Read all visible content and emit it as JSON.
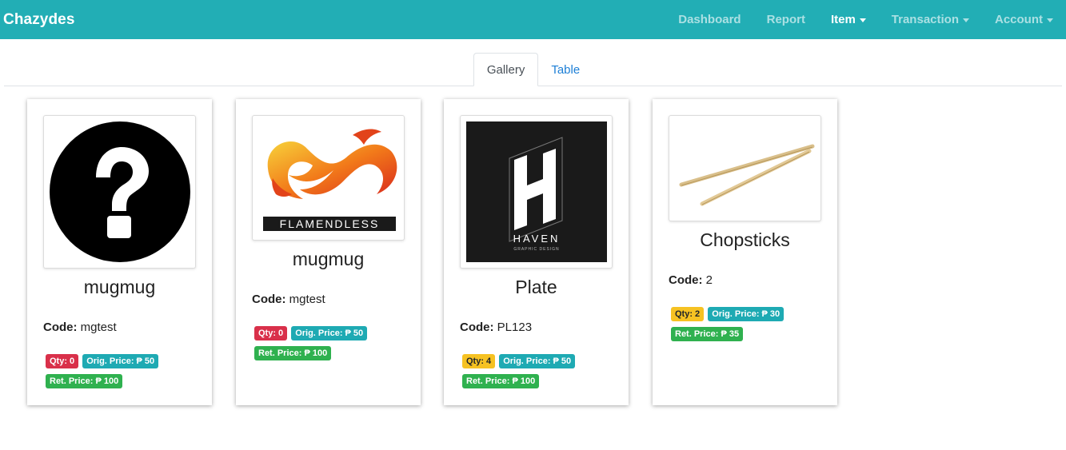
{
  "navbar": {
    "brand": "Chazydes",
    "items": [
      {
        "label": "Dashboard"
      },
      {
        "label": "Report"
      },
      {
        "label": "Item"
      },
      {
        "label": "Transaction"
      },
      {
        "label": "Account"
      }
    ]
  },
  "tabs": [
    {
      "label": "Gallery"
    },
    {
      "label": "Table"
    }
  ],
  "items": [
    {
      "name": "mugmug",
      "code_label": "Code:",
      "code": "mgtest",
      "qty": "Qty: 0",
      "orig": "Orig. Price: ₱ 50",
      "ret": "Ret. Price: ₱ 100",
      "image": "question-mark-icon"
    },
    {
      "name": "mugmug",
      "code_label": "Code:",
      "code": "mgtest",
      "qty": "Qty: 0",
      "orig": "Orig. Price: ₱ 50",
      "ret": "Ret. Price: ₱ 100",
      "image": "flamendless-logo",
      "logo_text": "FLAMENDLESS"
    },
    {
      "name": "Plate",
      "code_label": "Code:",
      "code": "PL123",
      "qty": "Qty: 4",
      "orig": "Orig. Price: ₱ 50",
      "ret": "Ret. Price: ₱ 100",
      "image": "haven-logo",
      "logo_text": "HAVEN",
      "logo_subtext": "GRAPHIC DESIGN"
    },
    {
      "name": "Chopsticks",
      "code_label": "Code:",
      "code": "2",
      "qty": "Qty: 2",
      "orig": "Orig. Price: ₱ 30",
      "ret": "Ret. Price: ₱ 35",
      "image": "chopsticks-photo"
    }
  ],
  "colors": {
    "navbar": "#22aeb5",
    "qty_zero": "#d9304a",
    "qty_stock": "#f6c222",
    "orig_price": "#1eaab3",
    "ret_price": "#2fb14f"
  }
}
